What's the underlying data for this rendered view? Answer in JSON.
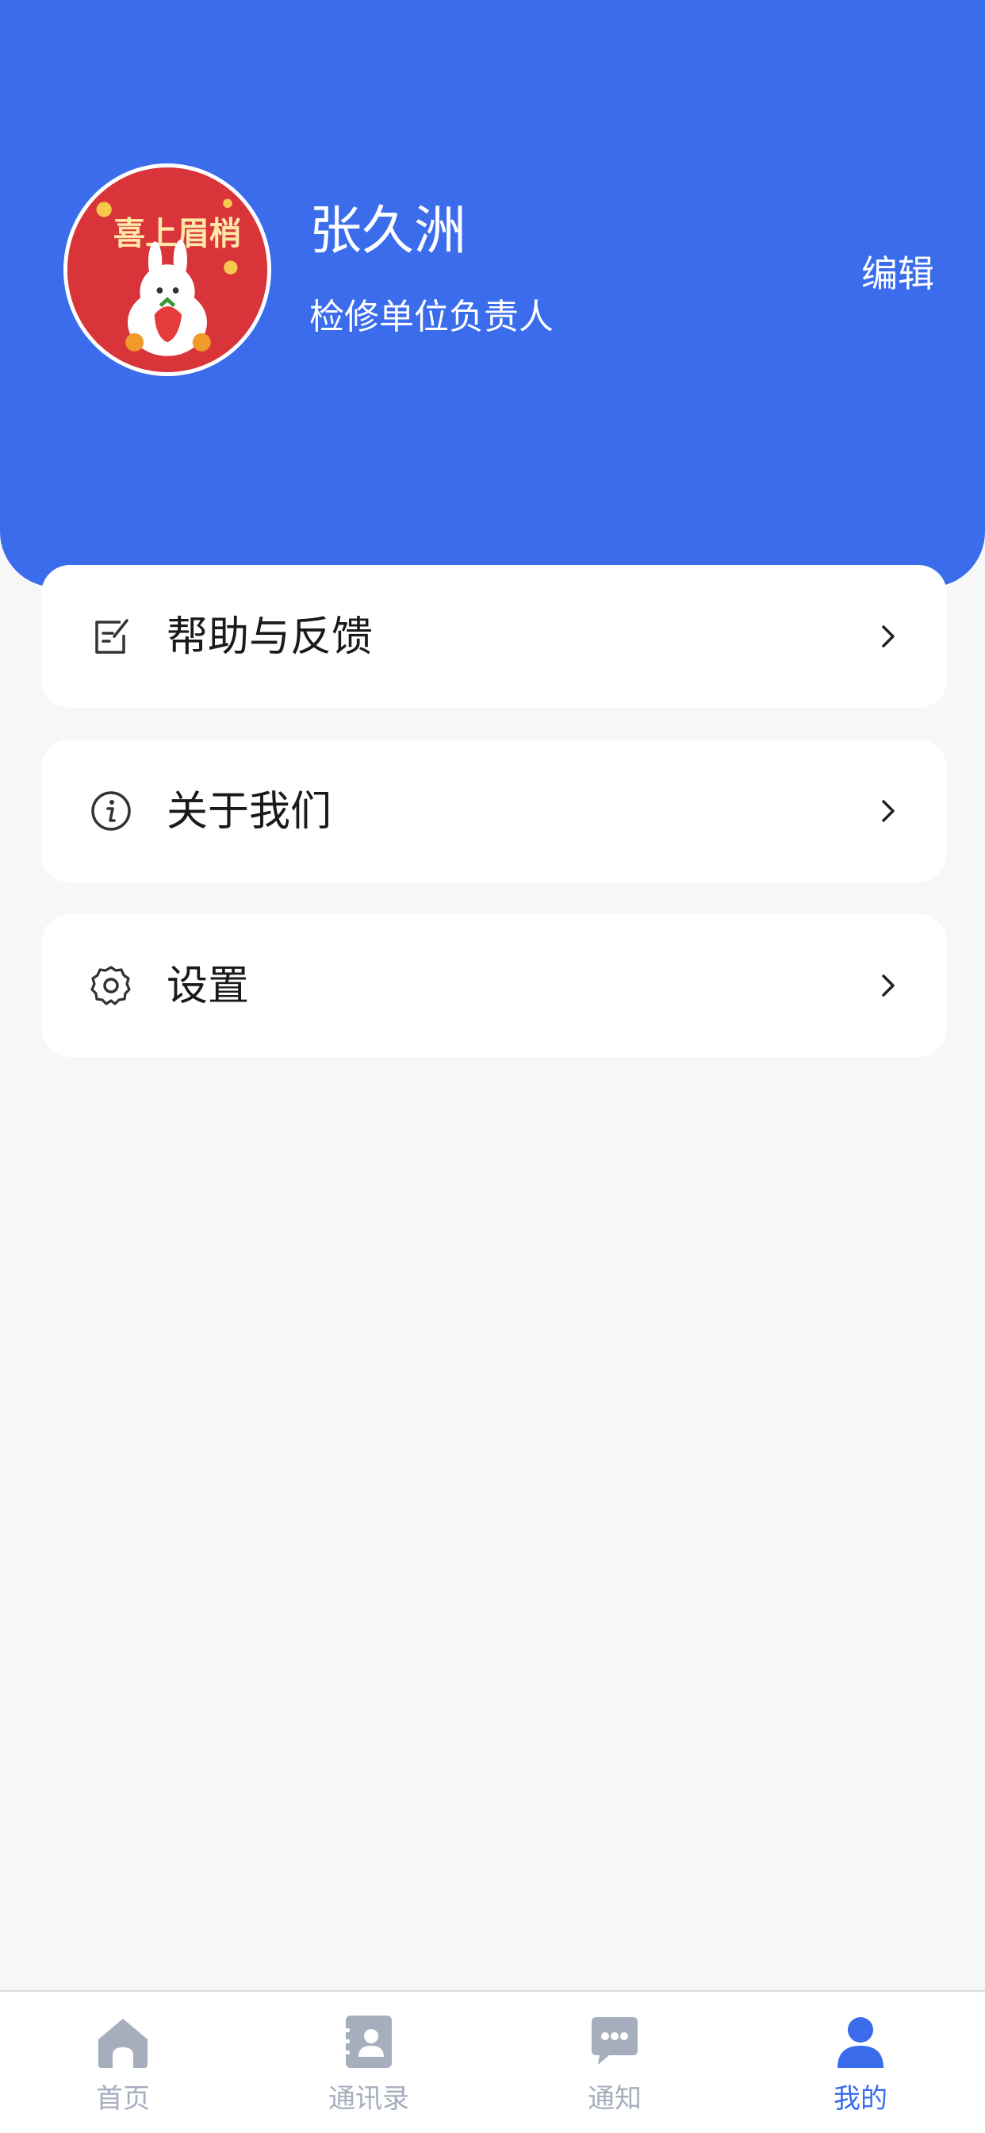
{
  "profile": {
    "name": "张久洲",
    "role": "检修单位负责人",
    "edit_label": "编辑",
    "avatar_text": "喜上眉梢"
  },
  "menu": [
    {
      "label": "帮助与反馈",
      "icon": "edit-note-icon"
    },
    {
      "label": "关于我们",
      "icon": "info-icon"
    },
    {
      "label": "设置",
      "icon": "gear-icon"
    }
  ],
  "tabbar": {
    "items": [
      {
        "label": "首页",
        "icon": "home-icon",
        "active": false
      },
      {
        "label": "通讯录",
        "icon": "contacts-icon",
        "active": false
      },
      {
        "label": "通知",
        "icon": "chat-bubble-icon",
        "active": false
      },
      {
        "label": "我的",
        "icon": "user-icon",
        "active": true
      }
    ]
  },
  "colors": {
    "primary": "#3a6cec",
    "background": "#f7f7f7",
    "inactive_tab": "#a6adbd",
    "avatar_red": "#d8343a"
  }
}
